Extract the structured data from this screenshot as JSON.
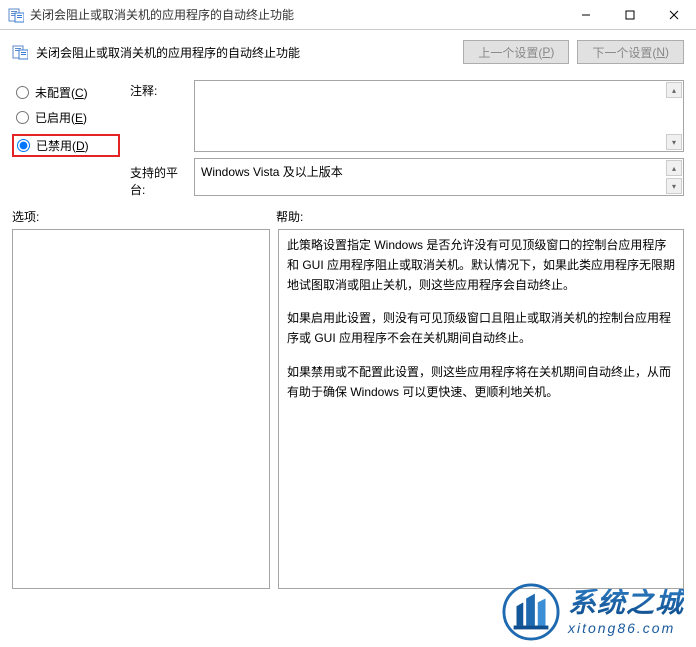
{
  "window": {
    "title": "关闭会阻止或取消关机的应用程序的自动终止功能"
  },
  "header": {
    "setting_title": "关闭会阻止或取消关机的应用程序的自动终止功能",
    "prev_btn": "上一个设置(",
    "prev_key": "P",
    "next_btn": "下一个设置(",
    "next_key": "N",
    "btn_suffix": ")"
  },
  "radios": {
    "not_configured": "未配置(",
    "not_configured_key": "C",
    "enabled": "已启用(",
    "enabled_key": "E",
    "disabled": "已禁用(",
    "disabled_key": "D",
    "suffix": ")",
    "selected": "disabled"
  },
  "labels": {
    "comment": "注释:",
    "supported": "支持的平台:",
    "options": "选项:",
    "help": "帮助:"
  },
  "fields": {
    "comment_value": "",
    "supported_value": "Windows Vista 及以上版本"
  },
  "help": {
    "p1": "此策略设置指定 Windows 是否允许没有可见顶级窗口的控制台应用程序和 GUI 应用程序阻止或取消关机。默认情况下，如果此类应用程序无限期地试图取消或阻止关机，则这些应用程序会自动终止。",
    "p2": "如果启用此设置，则没有可见顶级窗口且阻止或取消关机的控制台应用程序或 GUI 应用程序不会在关机期间自动终止。",
    "p3": "如果禁用或不配置此设置，则这些应用程序将在关机期间自动终止，从而有助于确保 Windows 可以更快速、更顺利地关机。"
  },
  "watermark": {
    "main": "系统之城",
    "sub": "xitong86.com"
  }
}
